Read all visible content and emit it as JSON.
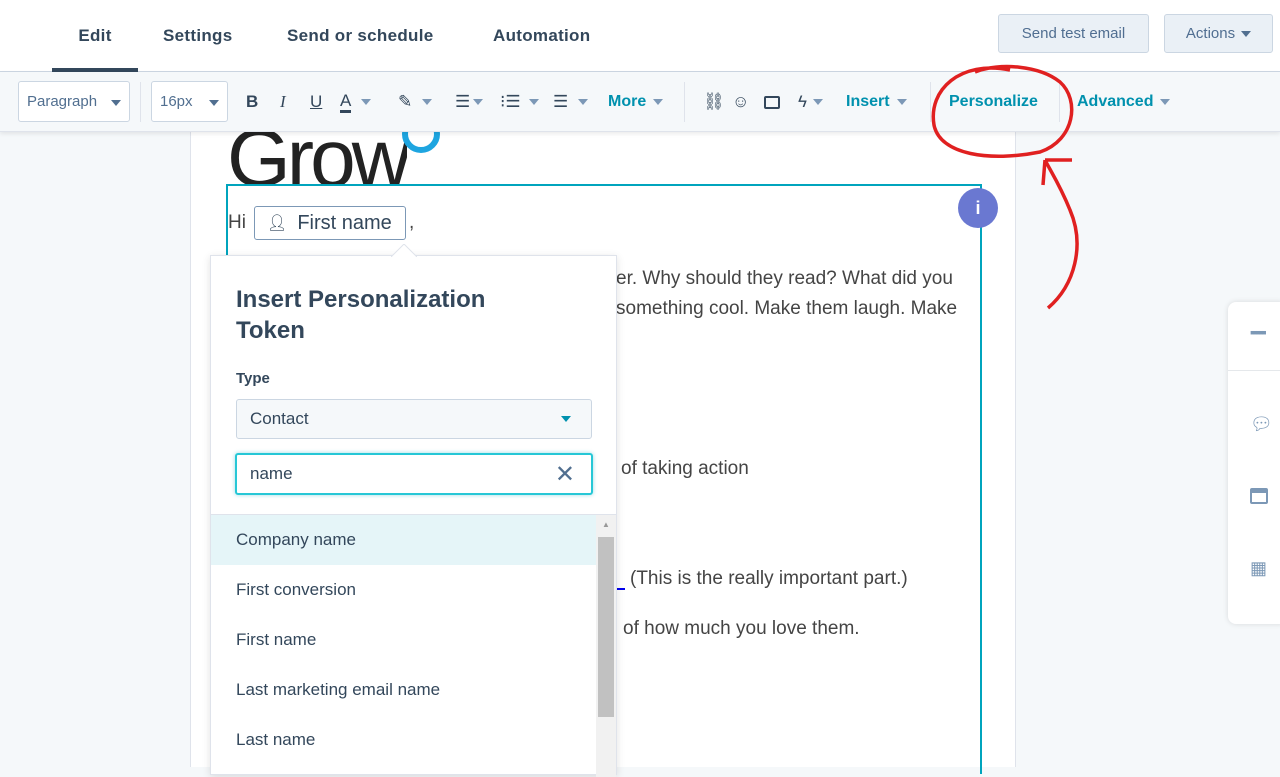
{
  "tabs": [
    {
      "label": "Edit",
      "active": true
    },
    {
      "label": "Settings"
    },
    {
      "label": "Send or schedule"
    },
    {
      "label": "Automation"
    }
  ],
  "header": {
    "send_test": "Send test email",
    "actions": "Actions"
  },
  "toolbar": {
    "paragraph": "Paragraph",
    "font_size": "16px",
    "bold": "B",
    "italic": "I",
    "underline": "U",
    "font_color": "A",
    "more": "More",
    "insert": "Insert",
    "personalize": "Personalize",
    "advanced": "Advanced"
  },
  "email": {
    "logo_text": "Grow",
    "greeting": "Hi",
    "token": "First name",
    "comma": ",",
    "line1": "er. Why should they read? What did you",
    "line2": "something cool. Make them laugh. Make",
    "line3": "of taking action",
    "line4": "(This is the really important part.)",
    "line5": "of how much you love them.",
    "info": "i"
  },
  "popover": {
    "title": "Insert Personalization Token",
    "type_label": "Type",
    "type_value": "Contact",
    "search_value": "name",
    "items": [
      "Company name",
      "First conversion",
      "First name",
      "Last marketing email name",
      "Last name"
    ],
    "highlighted": "Company name"
  },
  "colors": {
    "accent": "#0091ae",
    "focus": "#00a4bd",
    "annotation": "#e02020",
    "info_badge": "#6a78d1"
  },
  "rail_icons": [
    "grid-icon",
    "chat-icon",
    "inbox-icon",
    "calendar-icon"
  ]
}
